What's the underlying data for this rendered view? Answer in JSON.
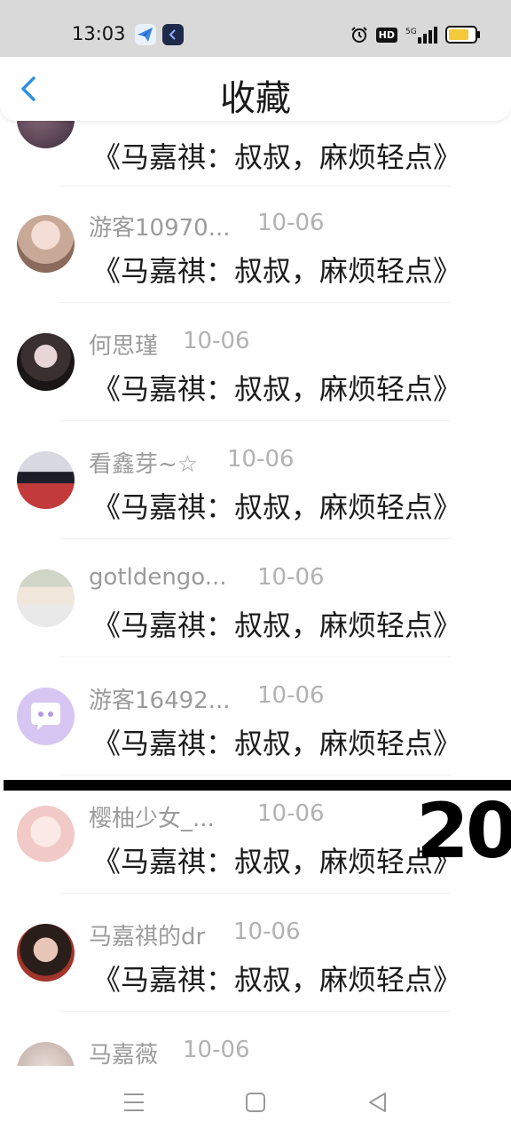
{
  "status": {
    "time": "13:03",
    "hd": "HD",
    "network": "5G"
  },
  "header": {
    "title": "收藏"
  },
  "items": [
    {
      "name": "",
      "time": "",
      "text": "《马嘉祺：叔叔，麻烦轻点》"
    },
    {
      "name": "游客10970...",
      "time": "10-06",
      "text": "《马嘉祺：叔叔，麻烦轻点》"
    },
    {
      "name": "何思瑾",
      "time": "10-06",
      "text": "《马嘉祺：叔叔，麻烦轻点》"
    },
    {
      "name": "看鑫芽~☆",
      "time": "10-06",
      "text": "《马嘉祺：叔叔，麻烦轻点》"
    },
    {
      "name": "gotldengo...",
      "time": "10-06",
      "text": "《马嘉祺：叔叔，麻烦轻点》"
    },
    {
      "name": "游客16492...",
      "time": "10-06",
      "text": "《马嘉祺：叔叔，麻烦轻点》"
    },
    {
      "name": "樱柚少女_...",
      "time": "10-06",
      "text": "《马嘉祺：叔叔，麻烦轻点》"
    },
    {
      "name": "马嘉祺的dr",
      "time": "10-06",
      "text": "《马嘉祺：叔叔，麻烦轻点》"
    },
    {
      "name": "马嘉薇",
      "time": "10-06",
      "text": ""
    }
  ],
  "overlay": {
    "number": "20"
  }
}
